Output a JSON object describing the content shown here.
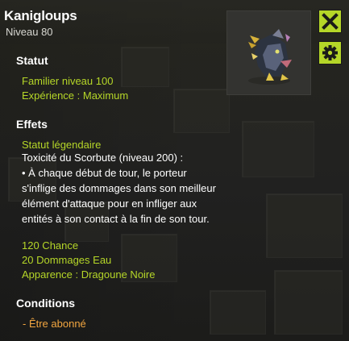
{
  "tooltip": {
    "item_name": "Kanigloups",
    "item_level": "Niveau 80",
    "sections": {
      "statut": {
        "title": "Statut",
        "lines": [
          "Familier niveau 100",
          "Expérience : Maximum"
        ]
      },
      "effets": {
        "title": "Effets",
        "line_status": "Statut légendaire",
        "line_toxicity": "Toxicité du Scorbute (niveau 200) :",
        "description": "• À chaque début de tour, le porteur s'inflige des dommages dans son meilleur élément d'attaque pour en infliger aux entités à son contact à la fin de son tour.",
        "line_chance": "120 Chance",
        "line_water": "20 Dommages Eau",
        "line_appearance": "Apparence : Dragoune Noire"
      },
      "conditions": {
        "title": "Conditions",
        "lines": [
          "- Être abonné"
        ]
      }
    },
    "icons": {
      "close": "close-x-icon",
      "settings": "gear-icon",
      "item_image": "pet-dragoune-icon"
    },
    "colors": {
      "accent_green": "#b5d628",
      "condition_orange": "#f2a640",
      "background": "#222220",
      "title_white": "#ffffff"
    }
  }
}
